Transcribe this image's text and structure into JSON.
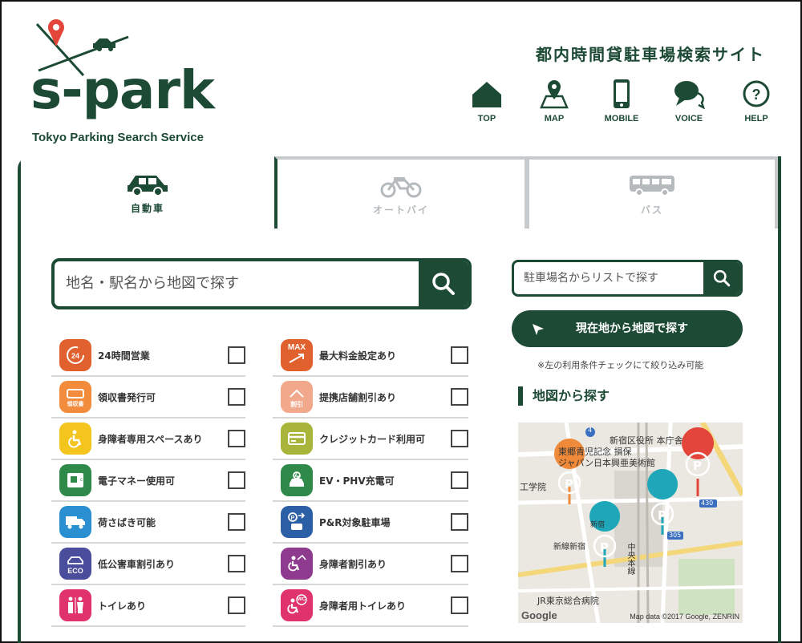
{
  "header": {
    "logo_text": "s-park",
    "logo_sub": "Tokyo Parking Search Service",
    "site_title": "都内時間貸駐車場検索サイト",
    "nav": [
      {
        "label": "TOP",
        "icon": "house-icon"
      },
      {
        "label": "MAP",
        "icon": "map-pin-icon"
      },
      {
        "label": "MOBILE",
        "icon": "mobile-phone-icon"
      },
      {
        "label": "VOICE",
        "icon": "speech-bubble-icon"
      },
      {
        "label": "HELP",
        "icon": "question-circle-icon"
      }
    ]
  },
  "tabs": [
    {
      "label": "自動車",
      "icon": "car-icon",
      "active": true
    },
    {
      "label": "オートバイ",
      "icon": "motorcycle-icon",
      "active": false
    },
    {
      "label": "バス",
      "icon": "bus-icon",
      "active": false
    }
  ],
  "search": {
    "main_placeholder": "地名・駅名から地図で探す",
    "list_placeholder": "駐車場名からリストで探す",
    "locate_label": "現在地から地図で探す",
    "note": "※左の利用条件チェックにて絞り込み可能",
    "map_heading": "地図から探す"
  },
  "filters": {
    "left": [
      {
        "label": "24時間営業",
        "icon": "24-hours-icon",
        "color": "#e0612d"
      },
      {
        "label": "領収書発行可",
        "icon": "receipt-icon",
        "color": "#f28b3c"
      },
      {
        "label": "身障者専用スペースあり",
        "icon": "wheelchair-icon",
        "color": "#f3c51d"
      },
      {
        "label": "電子マネー使用可",
        "icon": "e-money-icon",
        "color": "#2f8a4a"
      },
      {
        "label": "荷さばき可能",
        "icon": "truck-icon",
        "color": "#2a8fd0"
      },
      {
        "label": "低公害車割引あり",
        "icon": "eco-car-icon",
        "color": "#4a4c9c"
      },
      {
        "label": "トイレあり",
        "icon": "toilet-icon",
        "color": "#e0336d"
      }
    ],
    "right": [
      {
        "label": "最大料金設定あり",
        "icon": "max-price-icon",
        "color": "#e0612d"
      },
      {
        "label": "提携店舗割引あり",
        "icon": "shop-discount-icon",
        "color": "#f2a88a"
      },
      {
        "label": "クレジットカード利用可",
        "icon": "credit-card-icon",
        "color": "#a8b43a"
      },
      {
        "label": "EV・PHV充電可",
        "icon": "ev-charge-icon",
        "color": "#2f8a4a"
      },
      {
        "label": "P&R対象駐車場",
        "icon": "park-and-ride-icon",
        "color": "#2b5fa6"
      },
      {
        "label": "身障者割引あり",
        "icon": "wheelchair-discount-icon",
        "color": "#8e3a8f"
      },
      {
        "label": "身障者用トイレあり",
        "icon": "accessible-toilet-icon",
        "color": "#e0336d"
      }
    ],
    "icon_texts": {
      "receipt": "領収書",
      "max": "MAX",
      "discount": "割引",
      "eco": "ECO",
      "wc": "WC"
    }
  },
  "map": {
    "labels": [
      "新宿区役所 本庁舎",
      "東郷青児記念 損保",
      "ジャパン日本興亜美術館",
      "工学院",
      "新宿",
      "中央本線",
      "新線新宿",
      "JR東京総合病院",
      "305",
      "430",
      "4"
    ],
    "credit": "Map data ©2017 Google, ZENRIN",
    "google": "Google",
    "pin_text": "P"
  },
  "colors": {
    "brand": "#1d4a34",
    "tab_inactive": "#c6cacd",
    "pin_red": "#e4453a",
    "pin_orange": "#ee8a3a",
    "pin_teal": "#1fa6b8"
  }
}
